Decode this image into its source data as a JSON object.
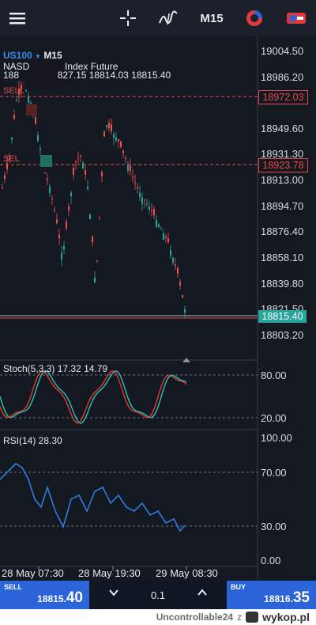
{
  "toolbar": {
    "menu_icon": "hamburger-menu-icon",
    "crosshair_icon": "crosshair-icon",
    "indicator_icon": "indicator-f-icon",
    "timeframe": "M15",
    "timer_icon": "chart-timer-icon",
    "trade_icon": "trade-icon"
  },
  "symbol": {
    "name": "US100",
    "dropdown_icon": "chevron-down-icon",
    "timeframe": "M15",
    "description_left": "NASD",
    "description_right": "Index Future",
    "ohlc_left": "188",
    "ohlc_right": "827.15 18814.03 18815.40"
  },
  "price_axis": [
    "19004.50",
    "18986.20",
    "18949.60",
    "18931.30",
    "18913.00",
    "18894.70",
    "18876.40",
    "18858.10",
    "18839.80",
    "18821.50",
    "18803.20"
  ],
  "orders": [
    {
      "label": "SELL",
      "price": "18972.03",
      "color": "#e34b4b"
    },
    {
      "label": "SEL",
      "price": "18923.78",
      "color": "#e34b4b"
    }
  ],
  "current_price": "18815.40",
  "stoch": {
    "label": "Stoch(5,3,3) 17.32 14.79",
    "axis": [
      "80.00",
      "20.00"
    ]
  },
  "rsi": {
    "label": "RSI(14) 28.30",
    "axis": [
      "100.00",
      "70.00",
      "30.00",
      "0.00"
    ]
  },
  "time_axis": [
    "28 May 07:30",
    "28 May 19:30",
    "29 May 08:30"
  ],
  "trade_panel": {
    "sell_label": "SELL",
    "sell_price_main": "18815.",
    "sell_price_big": "40",
    "lot": "0.1",
    "buy_label": "BUY",
    "buy_price_main": "18816.",
    "buy_price_big": "35",
    "decrease_icon": "chevron-down-icon",
    "increase_icon": "chevron-up-icon"
  },
  "footer": {
    "username": "Uncontrollable24",
    "z": "z",
    "brand": "wykop.pl"
  },
  "colors": {
    "up": "#26a69a",
    "down": "#ef5350",
    "accent": "#2b63d9",
    "stoch_k": "#26c6b9",
    "stoch_d": "#e53935",
    "rsi": "#2f7de1"
  }
}
